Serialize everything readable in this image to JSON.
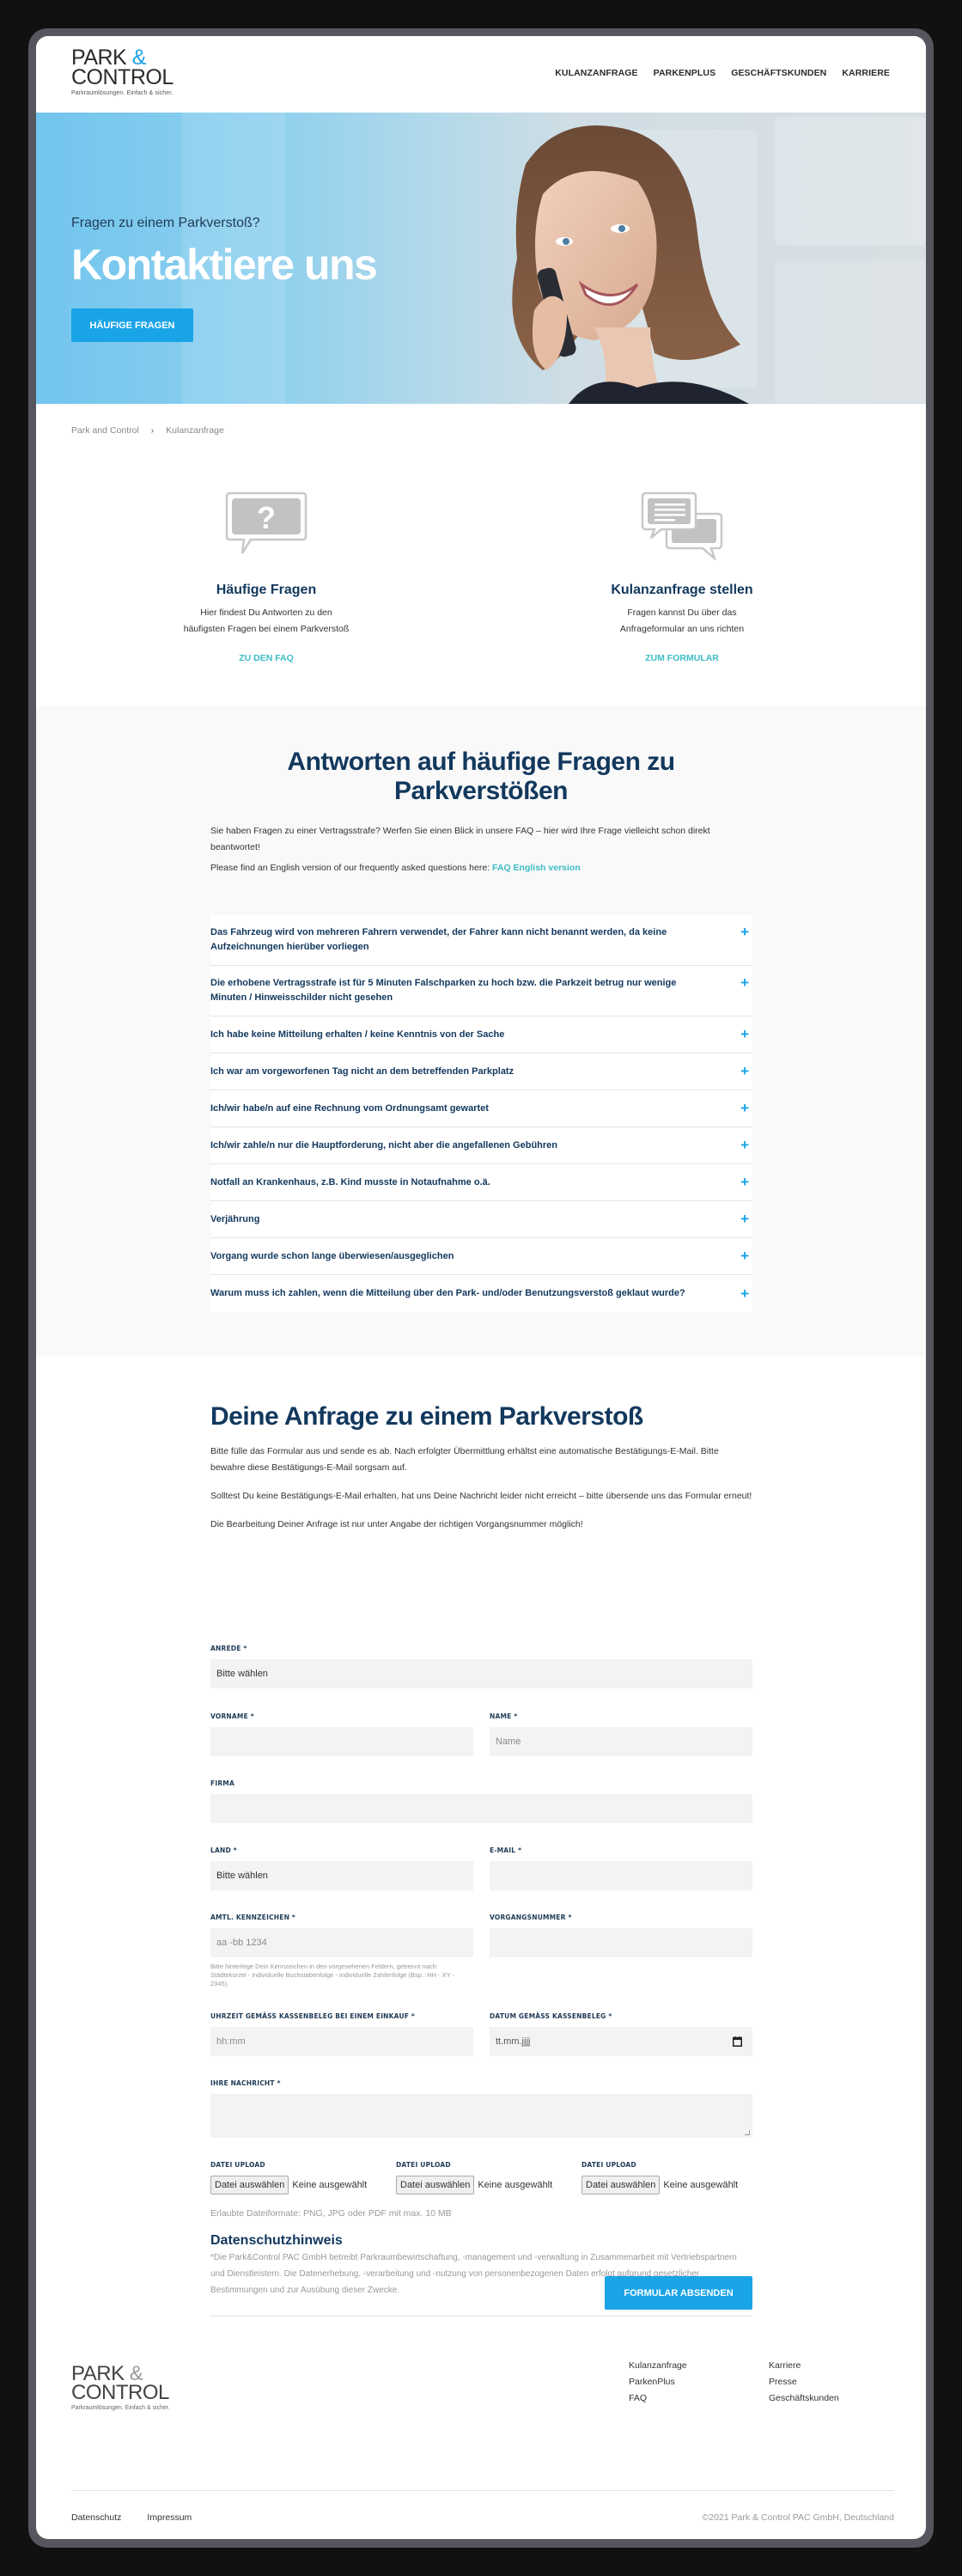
{
  "brand": {
    "logo_line1": "PARK",
    "logo_amp": "&",
    "logo_line2": "CONTROL",
    "tagline": "Parkraumlösungen. Einfach & sicher.",
    "accent_color": "#1aa4e8",
    "navy_color": "#12385d",
    "teal_link_color": "#3dbdc5"
  },
  "nav": {
    "items": [
      {
        "label": "KULANZANFRAGE"
      },
      {
        "label": "PARKENPLUS"
      },
      {
        "label": "GESCHÄFTSKUNDEN"
      },
      {
        "label": "KARRIERE"
      }
    ]
  },
  "hero": {
    "subtitle": "Fragen zu einem Parkverstoß?",
    "title": "Kontaktiere uns",
    "button": "HÄUFIGE FRAGEN"
  },
  "breadcrumb": {
    "items": [
      {
        "label": "Park and Control"
      },
      {
        "label": "Kulanzanfrage"
      }
    ],
    "separator": "›"
  },
  "cards": [
    {
      "icon": "question-bubble-icon",
      "title": "Häufige Fragen",
      "text_line1": "Hier findest Du Antworten zu den",
      "text_line2": "häufigsten Fragen bei einem Parkverstoß",
      "link": "ZU DEN FAQ"
    },
    {
      "icon": "chat-bubbles-icon",
      "title": "Kulanzanfrage stellen",
      "text_line1": "Fragen kannst Du über das",
      "text_line2": "Anfrageformular an uns richten",
      "link": "ZUM FORMULAR"
    }
  ],
  "faq": {
    "title": "Antworten auf häufige Fragen zu Parkverstößen",
    "intro": "Sie haben Fragen zu einer Vertragsstrafe? Werfen Sie einen Blick in unsere FAQ – hier wird Ihre Frage vielleicht schon direkt beantwortet!",
    "english_prefix": "Please find an English version of our frequently asked questions here: ",
    "english_link": "FAQ English version",
    "expand_icon": "+",
    "items": [
      {
        "question": "Das Fahrzeug wird von mehreren Fahrern verwendet, der Fahrer kann nicht benannt werden, da keine Aufzeichnungen hierüber vorliegen"
      },
      {
        "question": "Die erhobene Vertragsstrafe ist für 5 Minuten Falschparken zu hoch bzw. die Parkzeit betrug nur wenige Minuten / Hinweisschilder nicht gesehen"
      },
      {
        "question": "Ich habe keine Mitteilung erhalten / keine Kenntnis von der Sache"
      },
      {
        "question": "Ich war am vorgeworfenen Tag nicht an dem betreffenden Parkplatz"
      },
      {
        "question": "Ich/wir habe/n auf eine Rechnung vom Ordnungsamt gewartet"
      },
      {
        "question": "Ich/wir zahle/n nur die Hauptforderung, nicht aber die angefallenen Gebühren"
      },
      {
        "question": "Notfall an Krankenhaus, z.B. Kind musste in Notaufnahme o.ä."
      },
      {
        "question": "Verjährung"
      },
      {
        "question": "Vorgang wurde schon lange überwiesen/ausgeglichen"
      },
      {
        "question": "Warum muss ich zahlen, wenn die Mitteilung über den Park- und/oder Benutzungsverstoß geklaut wurde?"
      }
    ]
  },
  "form": {
    "title": "Deine Anfrage zu einem Parkverstoß",
    "text1": "Bitte fülle das Formular aus und sende es ab. Nach erfolgter Übermittlung erhältst eine automatische Bestätigungs-E-Mail. Bitte bewahre diese Bestätigungs-E-Mail sorgsam auf.",
    "text2": "Solltest Du keine Bestätigungs-E-Mail erhalten, hat uns Deine Nachricht leider nicht erreicht – bitte übersende uns das Formular erneut!",
    "text3": "Die Bearbeitung Deiner Anfrage ist nur unter Angabe der richtigen Vorgangsnummer möglich!",
    "fields": {
      "anrede": {
        "label": "ANREDE *",
        "value": "Bitte wählen"
      },
      "vorname": {
        "label": "VORNAME *",
        "value": "",
        "placeholder": ""
      },
      "name": {
        "label": "NAME *",
        "value": "",
        "placeholder": "Name"
      },
      "firma": {
        "label": "FIRMA",
        "value": "",
        "placeholder": ""
      },
      "land": {
        "label": "LAND *",
        "value": "Bitte wählen"
      },
      "email": {
        "label": "E-MAIL *",
        "value": "",
        "placeholder": ""
      },
      "kennzeichen": {
        "label": "AMTL. KENNZEICHEN *",
        "value": "",
        "placeholder": "aa -bb 1234",
        "hint": "Bitte hinterlege Dein Kennzeichen in den vorgesehenen Feldern, getrennt nach: Städtekürzel - individuelle Buchstabenfolge - individuelle Zahlenfolge (Bsp.: HH - XY - 2345)."
      },
      "vorgangsnummer": {
        "label": "VORGANGSNUMMER *",
        "value": "",
        "placeholder": ""
      },
      "uhrzeit": {
        "label": "UHRZEIT GEMÄSS KASSENBELEG BEI EINEM EINKAUF *",
        "value": "",
        "placeholder": "hh:mm"
      },
      "datum": {
        "label": "DATUM GEMÄSS KASSENBELEG *",
        "value": "",
        "placeholder": "tt.mm.jjjj"
      },
      "nachricht": {
        "label": "IHRE NACHRICHT *",
        "value": ""
      }
    },
    "uploads": [
      {
        "label": "DATEI UPLOAD",
        "button": "Datei auswählen",
        "status": "Keine ausgewählt"
      },
      {
        "label": "DATEI UPLOAD",
        "button": "Datei auswählen",
        "status": "Keine ausgewählt"
      },
      {
        "label": "DATEI UPLOAD",
        "button": "Datei auswählen",
        "status": "Keine ausgewählt"
      }
    ],
    "allowed_formats": "Erlaubte Dateiformate: PNG, JPG oder PDF mit max. 10 MB",
    "privacy_title": "Datenschutzhinweis",
    "privacy_text": "*Die Park&Control PAC GmbH betreibt Parkraumbewirtschaftung, -management und -verwaltung in Zusammenarbeit mit Vertriebspartnern und Dienstleistern. Die Datenerhebung, -verarbeitung und -nutzung von personenbezogenen Daten erfolgt aufgrund gesetzlicher Bestimmungen und zur Ausübung dieser Zwecke.",
    "submit": "FORMULAR ABSENDEN"
  },
  "footer": {
    "col1": [
      {
        "label": "Kulanzanfrage"
      },
      {
        "label": "ParkenPlus"
      },
      {
        "label": "FAQ"
      }
    ],
    "col2": [
      {
        "label": "Karriere"
      },
      {
        "label": "Presse"
      },
      {
        "label": "Geschäftskunden"
      }
    ],
    "bottom_links": [
      {
        "label": "Datenschutz"
      },
      {
        "label": "Impressum"
      }
    ],
    "copyright": "©2021 Park & Control PAC GmbH, Deutschland"
  }
}
